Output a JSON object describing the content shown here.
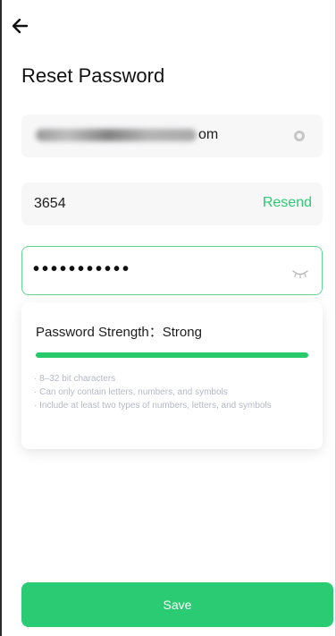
{
  "header": {
    "back_icon": "arrow-left-icon",
    "title": "Reset Password"
  },
  "email": {
    "visible_suffix": "om",
    "clear_icon": "clear-circle-icon"
  },
  "verification": {
    "code": "3654",
    "resend_label": "Resend"
  },
  "password": {
    "masked_value": "•••••••••••",
    "toggle_icon": "eye-closed-icon",
    "focus_color": "#5fd792"
  },
  "strength": {
    "label": "Password Strength：Strong",
    "level": 1.0,
    "bar_color": "#27c96b",
    "rules": [
      "· 8–32 bit characters",
      "· Can only contain letters, numbers, and symbols",
      "· Include at least two types of numbers, letters, and symbols"
    ]
  },
  "actions": {
    "save_label": "Save",
    "accent_color": "#2bcb74"
  }
}
